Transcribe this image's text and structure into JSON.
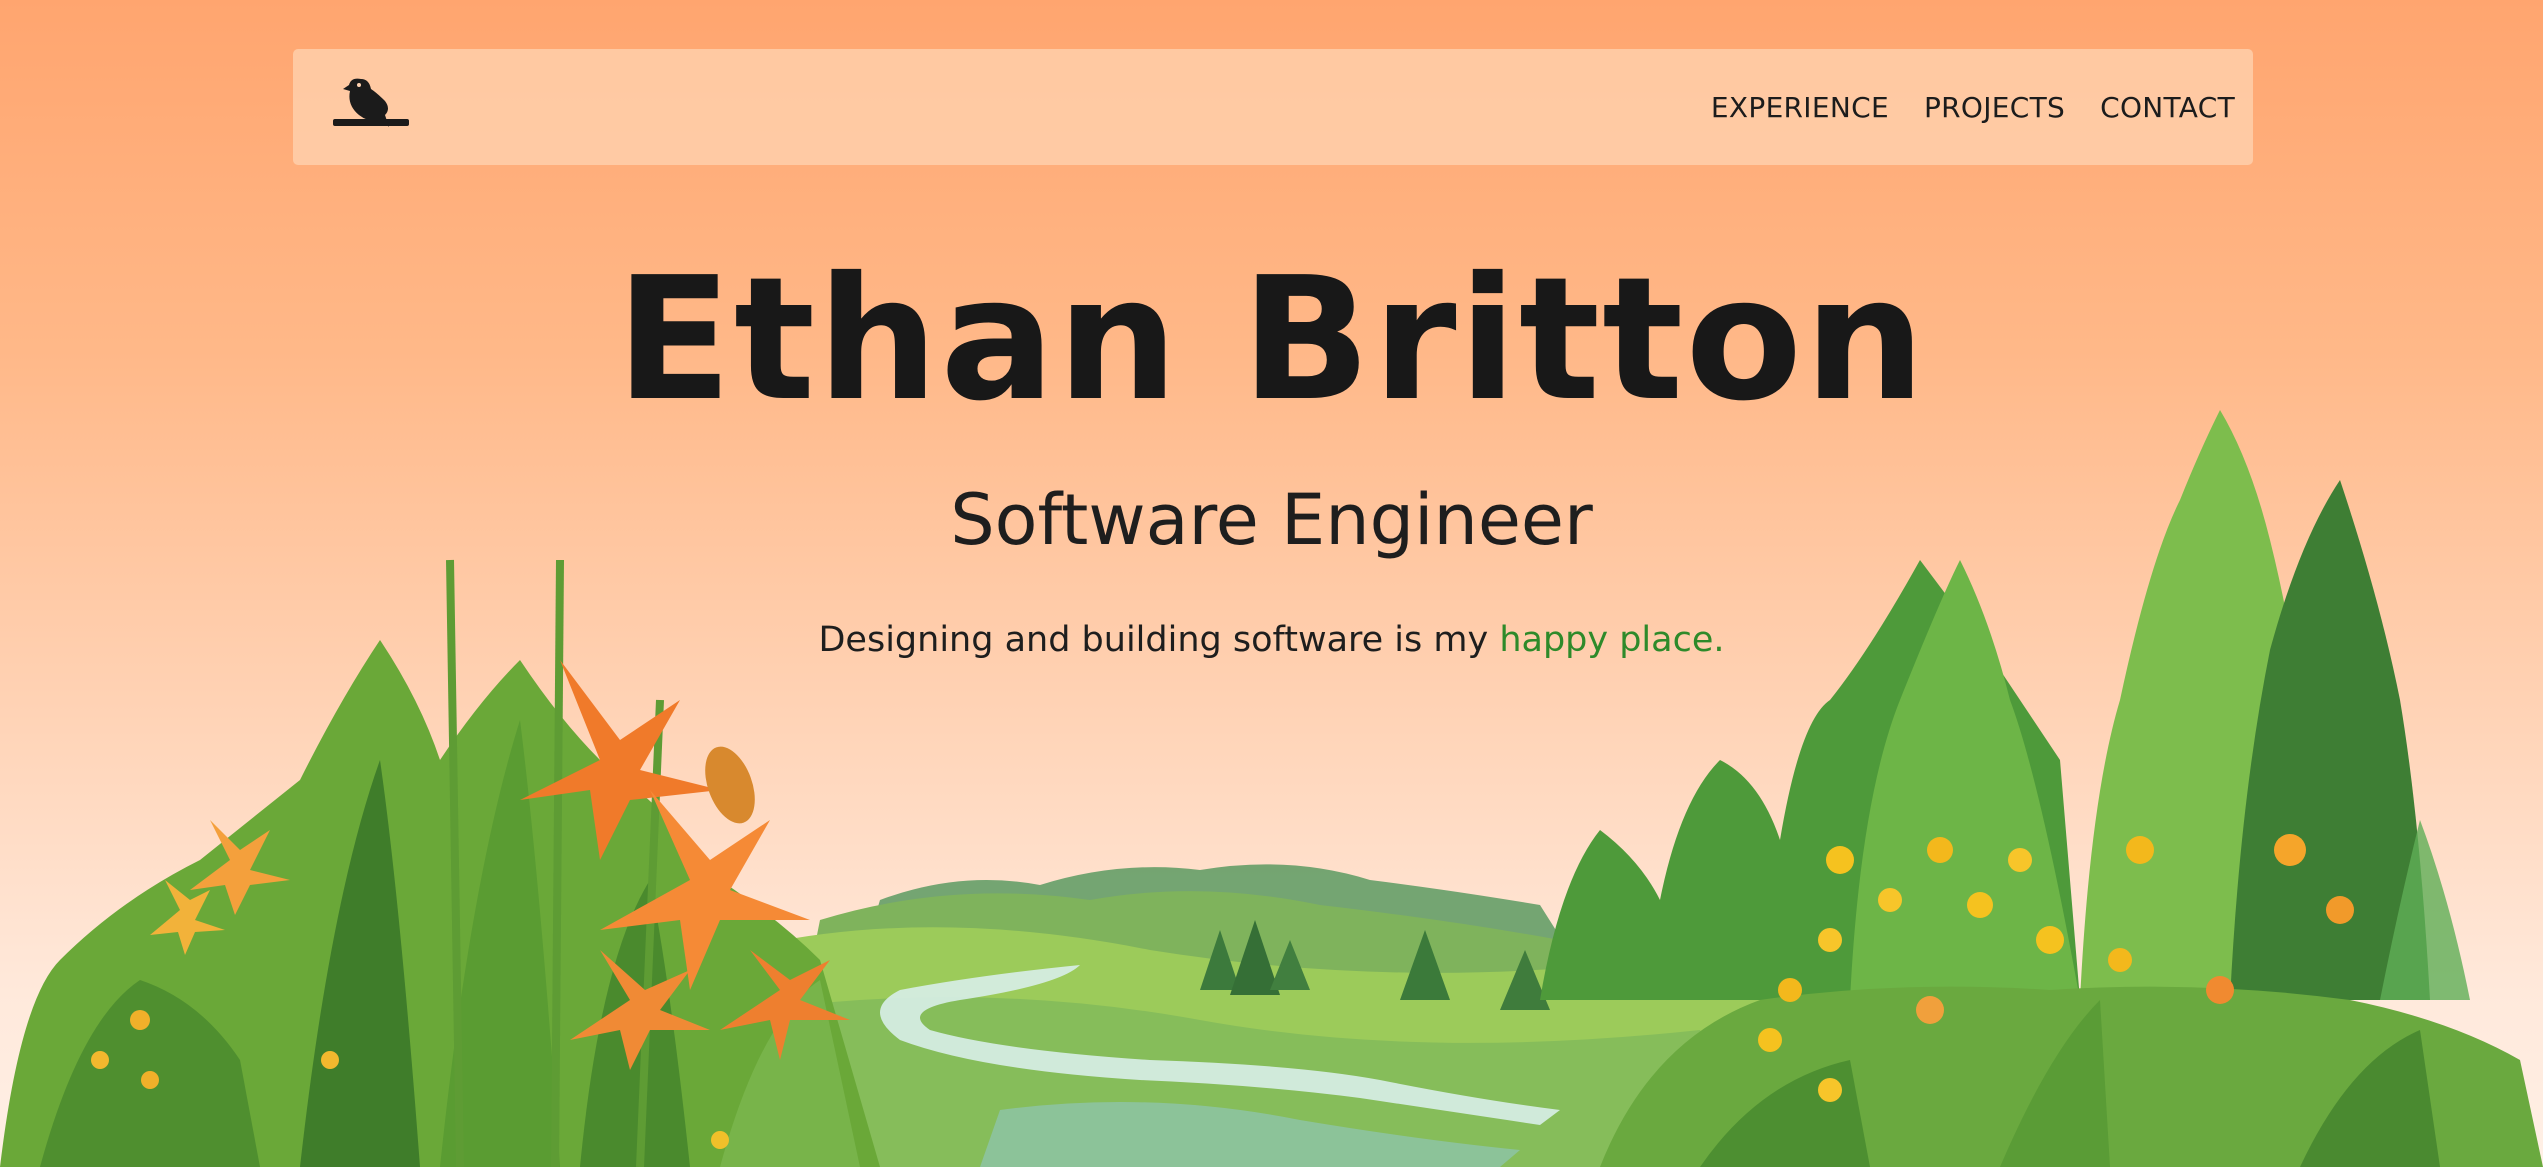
{
  "nav": {
    "logo_icon": "bird-logo-icon",
    "links": [
      "EXPERIENCE",
      "PROJECTS",
      "CONTACT"
    ]
  },
  "hero": {
    "name": "Ethan Britton",
    "role": "Software Engineer",
    "tagline_prefix": "Designing and building software is my ",
    "tagline_accent": "happy place."
  },
  "colors": {
    "background_top": "#ffa56f",
    "background_bottom": "#fff0e6",
    "nav_bg": "#ffd2b0",
    "text": "#181818",
    "accent": "#2e8a2a"
  },
  "illustration": "watercolor-landscape-illustration"
}
